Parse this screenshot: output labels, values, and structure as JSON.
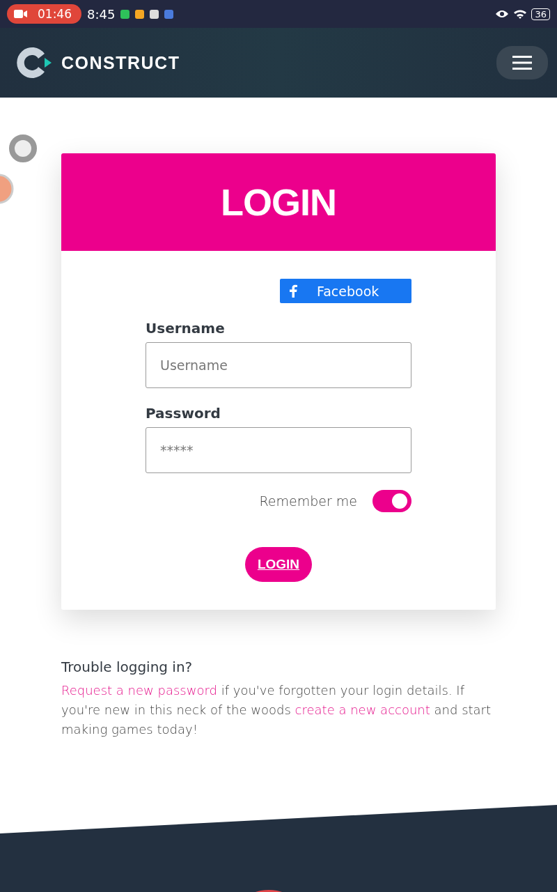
{
  "status_bar": {
    "recording_time": "01:46",
    "time": "8:45",
    "battery": "36"
  },
  "header": {
    "logo": "CONSTRUCT"
  },
  "login": {
    "title": "LOGIN",
    "facebook_button": "Facebook",
    "fields": [
      {
        "label": "Username",
        "placeholder": "Username"
      },
      {
        "label": "Password",
        "placeholder": "*****"
      }
    ],
    "remember": {
      "label": "Remember me",
      "on": true
    },
    "submit": "LOGIN"
  },
  "help": {
    "title": "Trouble logging in?",
    "parts": [
      {
        "kind": "link",
        "text": "Request a new password"
      },
      {
        "kind": "text",
        "text": " if you've forgotten your login details. If you're new in this neck of the woods "
      },
      {
        "kind": "link",
        "text": "create a new account"
      },
      {
        "kind": "text",
        "text": " and start making games today!"
      }
    ]
  }
}
